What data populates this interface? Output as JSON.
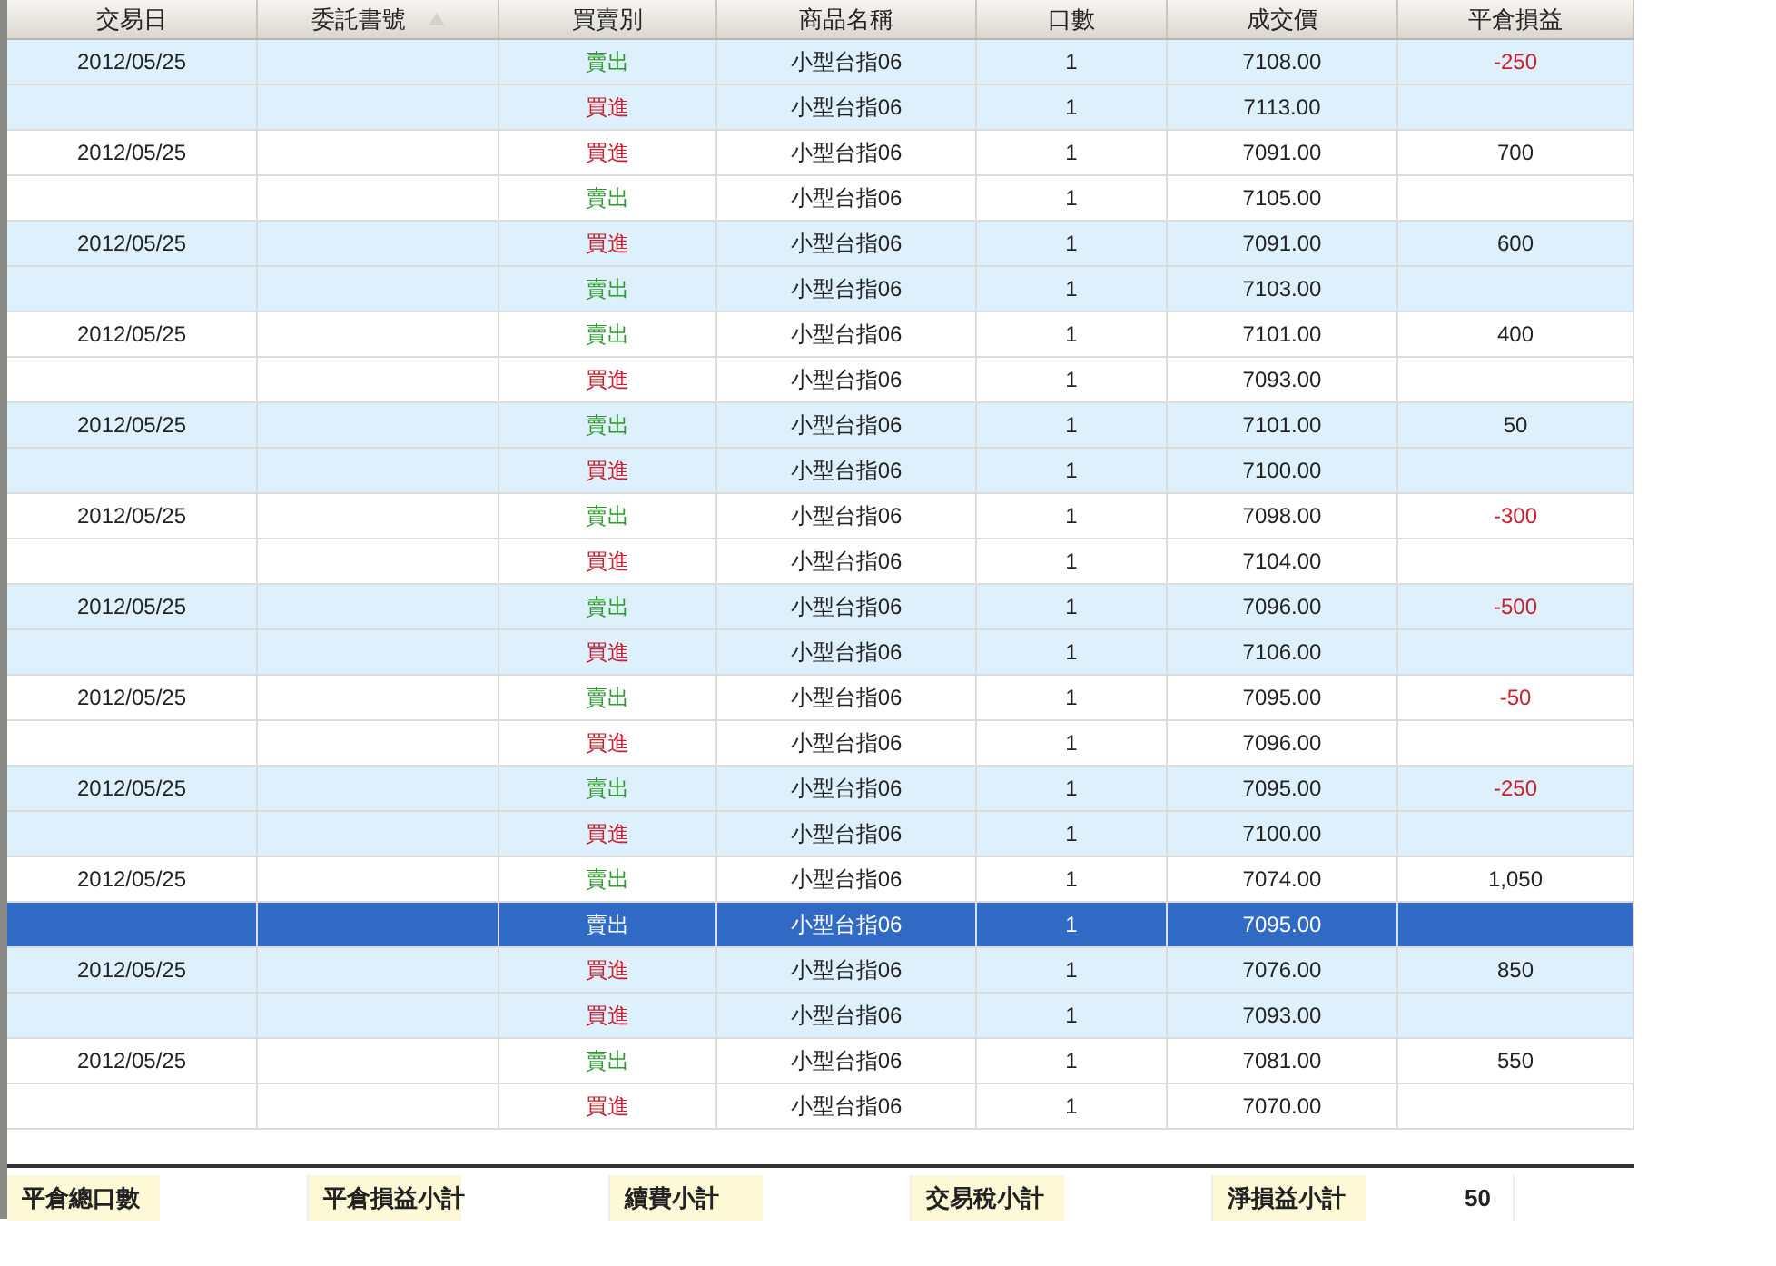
{
  "table": {
    "columns": [
      {
        "label": "交易日",
        "sorted": false
      },
      {
        "label": "委託書號",
        "sorted": true
      },
      {
        "label": "買賣別",
        "sorted": false
      },
      {
        "label": "商品名稱",
        "sorted": false
      },
      {
        "label": "口數",
        "sorted": false
      },
      {
        "label": "成交價",
        "sorted": false
      },
      {
        "label": "平倉損益",
        "sorted": false
      }
    ],
    "rows": [
      {
        "date": "2012/05/25",
        "kind": "sell",
        "side": "賣出",
        "product": "小型台指06",
        "qty": "1",
        "price": "7108.00",
        "pnl": "-250",
        "loss": true,
        "selected": false
      },
      {
        "kind": "buy",
        "side": "買進",
        "product": "小型台指06",
        "qty": "1",
        "price": "7113.00",
        "selected": false
      },
      {
        "date": "2012/05/25",
        "kind": "buy",
        "side": "買進",
        "product": "小型台指06",
        "qty": "1",
        "price": "7091.00",
        "pnl": "700",
        "loss": false,
        "selected": false
      },
      {
        "kind": "sell",
        "side": "賣出",
        "product": "小型台指06",
        "qty": "1",
        "price": "7105.00",
        "selected": false
      },
      {
        "date": "2012/05/25",
        "kind": "buy",
        "side": "買進",
        "product": "小型台指06",
        "qty": "1",
        "price": "7091.00",
        "pnl": "600",
        "loss": false,
        "selected": false
      },
      {
        "kind": "sell",
        "side": "賣出",
        "product": "小型台指06",
        "qty": "1",
        "price": "7103.00",
        "selected": false
      },
      {
        "date": "2012/05/25",
        "kind": "sell",
        "side": "賣出",
        "product": "小型台指06",
        "qty": "1",
        "price": "7101.00",
        "pnl": "400",
        "loss": false,
        "selected": false
      },
      {
        "kind": "buy",
        "side": "買進",
        "product": "小型台指06",
        "qty": "1",
        "price": "7093.00",
        "selected": false
      },
      {
        "date": "2012/05/25",
        "kind": "sell",
        "side": "賣出",
        "product": "小型台指06",
        "qty": "1",
        "price": "7101.00",
        "pnl": "50",
        "loss": false,
        "selected": false
      },
      {
        "kind": "buy",
        "side": "買進",
        "product": "小型台指06",
        "qty": "1",
        "price": "7100.00",
        "selected": false
      },
      {
        "date": "2012/05/25",
        "kind": "sell",
        "side": "賣出",
        "product": "小型台指06",
        "qty": "1",
        "price": "7098.00",
        "pnl": "-300",
        "loss": true,
        "selected": false
      },
      {
        "kind": "buy",
        "side": "買進",
        "product": "小型台指06",
        "qty": "1",
        "price": "7104.00",
        "selected": false
      },
      {
        "date": "2012/05/25",
        "kind": "sell",
        "side": "賣出",
        "product": "小型台指06",
        "qty": "1",
        "price": "7096.00",
        "pnl": "-500",
        "loss": true,
        "selected": false
      },
      {
        "kind": "buy",
        "side": "買進",
        "product": "小型台指06",
        "qty": "1",
        "price": "7106.00",
        "selected": false
      },
      {
        "date": "2012/05/25",
        "kind": "sell",
        "side": "賣出",
        "product": "小型台指06",
        "qty": "1",
        "price": "7095.00",
        "pnl": "-50",
        "loss": true,
        "selected": false
      },
      {
        "kind": "buy",
        "side": "買進",
        "product": "小型台指06",
        "qty": "1",
        "price": "7096.00",
        "selected": false
      },
      {
        "date": "2012/05/25",
        "kind": "sell",
        "side": "賣出",
        "product": "小型台指06",
        "qty": "1",
        "price": "7095.00",
        "pnl": "-250",
        "loss": true,
        "selected": false
      },
      {
        "kind": "buy",
        "side": "買進",
        "product": "小型台指06",
        "qty": "1",
        "price": "7100.00",
        "selected": false
      },
      {
        "date": "2012/05/25",
        "kind": "sell",
        "side": "賣出",
        "product": "小型台指06",
        "qty": "1",
        "price": "7074.00",
        "pnl": "1,050",
        "loss": false,
        "selected": false
      },
      {
        "kind": "sell",
        "side": "賣出",
        "product": "小型台指06",
        "qty": "1",
        "price": "7095.00",
        "selected": true
      },
      {
        "date": "2012/05/25",
        "kind": "buy",
        "side": "買進",
        "product": "小型台指06",
        "qty": "1",
        "price": "7076.00",
        "pnl": "850",
        "loss": false,
        "selected": false
      },
      {
        "kind": "buy",
        "side": "買進",
        "product": "小型台指06",
        "qty": "1",
        "price": "7093.00",
        "selected": false
      },
      {
        "date": "2012/05/25",
        "kind": "sell",
        "side": "賣出",
        "product": "小型台指06",
        "qty": "1",
        "price": "7081.00",
        "pnl": "550",
        "loss": false,
        "selected": false
      },
      {
        "kind": "buy",
        "side": "買進",
        "product": "小型台指06",
        "qty": "1",
        "price": "7070.00",
        "selected": false
      }
    ]
  },
  "summary": [
    {
      "label": "平倉總口數"
    },
    {
      "label": "平倉損益小計"
    },
    {
      "label": "續費小計"
    },
    {
      "label": "交易稅小計"
    },
    {
      "label": "淨損益小計",
      "value": "50"
    }
  ]
}
